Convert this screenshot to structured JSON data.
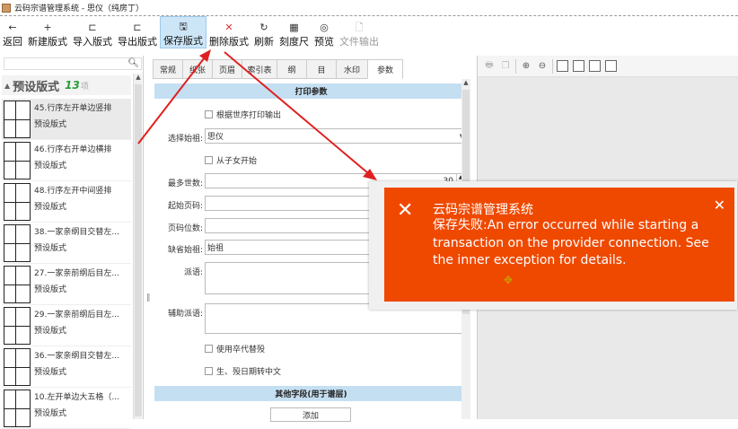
{
  "window": {
    "title": "云码宗谱管理系统 - 思仪（纯房丁）"
  },
  "toolbar": {
    "items": [
      {
        "icon": "←",
        "label": "返回"
      },
      {
        "icon": "+",
        "label": "新建版式"
      },
      {
        "icon": "⊏",
        "label": "导入版式"
      },
      {
        "icon": "⊏",
        "label": "导出版式"
      },
      {
        "icon": "🖫",
        "label": "保存版式"
      },
      {
        "icon": "✕",
        "label": "删除版式"
      },
      {
        "icon": "↻",
        "label": "刷新"
      },
      {
        "icon": "▦",
        "label": "刻度尺"
      },
      {
        "icon": "◎",
        "label": "预览"
      },
      {
        "icon": "🗋",
        "label": "文件输出"
      }
    ]
  },
  "left": {
    "group_label": "预设版式",
    "group_count": "13",
    "group_unit": "项",
    "items": [
      {
        "name": "45.行序左开单边竖排",
        "sub": "预设版式"
      },
      {
        "name": "46.行序右开单边横排",
        "sub": "预设版式"
      },
      {
        "name": "48.行序左开中间竖排",
        "sub": "预设版式"
      },
      {
        "name": "38.一家亲纲目交替左...",
        "sub": "预设版式"
      },
      {
        "name": "27.一家亲前纲后目左...",
        "sub": "预设版式"
      },
      {
        "name": "29.一家亲前纲后目左...",
        "sub": "预设版式"
      },
      {
        "name": "36.一家亲纲目交替左...",
        "sub": "预设版式"
      },
      {
        "name": "10.左开单边大五格（...",
        "sub": "预设版式"
      }
    ]
  },
  "tabs": [
    "常规",
    "纸张",
    "页眉",
    "索引表",
    "纲",
    "目",
    "水印",
    "参数"
  ],
  "params": {
    "section_print": "打印参数",
    "cb_print_by_gen": "根据世序打印输出",
    "select_ancestor_label": "选择始祖:",
    "select_ancestor_value": "思仪",
    "cb_from_children": "从子女开始",
    "max_gen_label": "最多世数:",
    "max_gen_value": "30",
    "start_page_label": "起始页码:",
    "page_pos_label": "页码位数:",
    "default_ancestor_label": "缺省始祖:",
    "default_ancestor_value": "始祖",
    "branch_label": "派语:",
    "aux_branch_label": "辅助派语:",
    "cb_use_gen_replace": "使用卒代替殁",
    "cb_birth_death_cn": "生、殁日期转中文",
    "section_other": "其他字段(用于谱层)",
    "add_button": "添加"
  },
  "toast": {
    "title": "云码宗谱管理系统",
    "message": "保存失败:An error occurred while starting a transaction on the provider connection. See the inner exception for details.",
    "bg_color": "#ef4900"
  }
}
